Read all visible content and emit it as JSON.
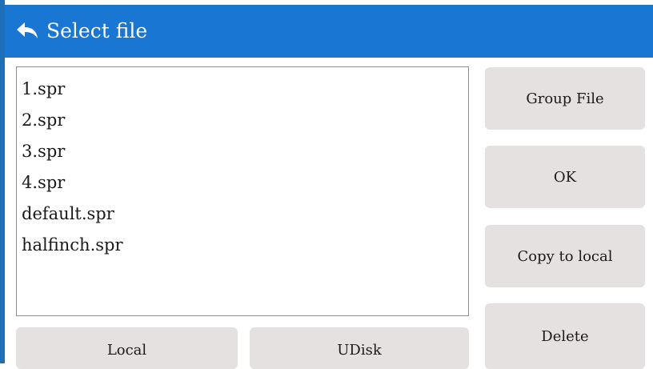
{
  "header": {
    "title": "Select file",
    "back_icon": "back-arrow-icon",
    "color": "#1976d2"
  },
  "files": [
    "1.spr",
    "2.spr",
    "3.spr",
    "4.spr",
    "default.spr",
    "halfinch.spr"
  ],
  "actions": {
    "group_file": "Group File",
    "ok": "OK",
    "copy_to_local": "Copy to local",
    "delete": "Delete"
  },
  "sources": {
    "local": "Local",
    "udisk": "UDisk"
  },
  "colors": {
    "button_bg": "#e5e1e0",
    "list_border": "#8c8c8c"
  }
}
